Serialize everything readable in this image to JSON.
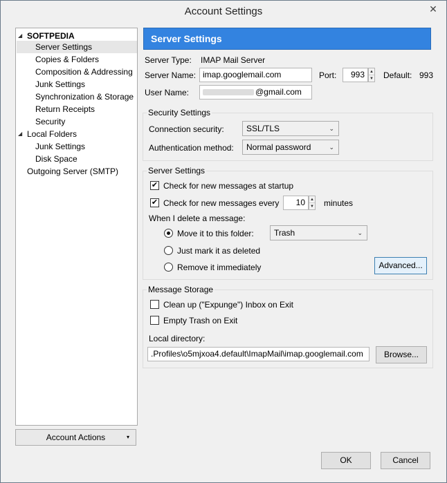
{
  "window": {
    "title": "Account Settings",
    "close_glyph": "✕"
  },
  "tree": {
    "items": [
      {
        "label": "SOFTPEDIA",
        "level": 0,
        "expanded": true,
        "bold": true
      },
      {
        "label": "Server Settings",
        "level": 1,
        "selected": true
      },
      {
        "label": "Copies & Folders",
        "level": 1
      },
      {
        "label": "Composition & Addressing",
        "level": 1
      },
      {
        "label": "Junk Settings",
        "level": 1
      },
      {
        "label": "Synchronization & Storage",
        "level": 1
      },
      {
        "label": "Return Receipts",
        "level": 1
      },
      {
        "label": "Security",
        "level": 1
      },
      {
        "label": "Local Folders",
        "level": 0,
        "expanded": true
      },
      {
        "label": "Junk Settings",
        "level": 1
      },
      {
        "label": "Disk Space",
        "level": 1
      },
      {
        "label": "Outgoing Server (SMTP)",
        "level": 0
      }
    ],
    "toggle_glyph": "◢"
  },
  "account_actions": {
    "label": "Account Actions",
    "caret": "▾"
  },
  "header": {
    "title": "Server Settings"
  },
  "server": {
    "type_label": "Server Type:",
    "type_value": "IMAP Mail Server",
    "name_label": "Server Name:",
    "name_value": "imap.googlemail.com",
    "port_label": "Port:",
    "port_value": "993",
    "default_label": "Default:",
    "default_value": "993",
    "user_label": "User Name:",
    "user_value": "@gmail.com"
  },
  "security": {
    "group_title": "Security Settings",
    "connection_label": "Connection security:",
    "connection_value": "SSL/TLS",
    "auth_label": "Authentication method:",
    "auth_value": "Normal password"
  },
  "server_settings": {
    "group_title": "Server Settings",
    "check_startup_label": "Check for new messages at startup",
    "check_startup": true,
    "check_every_label": "Check for new messages every",
    "check_every": true,
    "minutes_value": "10",
    "minutes_label": "minutes",
    "delete_label": "When I delete a message:",
    "move_label": "Move it to this folder:",
    "folder_value": "Trash",
    "mark_label": "Just mark it as deleted",
    "remove_label": "Remove it immediately",
    "selected_delete_option": "move",
    "advanced_label": "Advanced..."
  },
  "storage": {
    "group_title": "Message Storage",
    "expunge_label": "Clean up (\"Expunge\") Inbox on Exit",
    "expunge": false,
    "empty_trash_label": "Empty Trash on Exit",
    "empty_trash": false,
    "local_dir_label": "Local directory:",
    "local_dir_value": ".Profiles\\o5mjxoa4.default\\ImapMail\\imap.googlemail.com",
    "browse_label": "Browse..."
  },
  "footer": {
    "ok_label": "OK",
    "cancel_label": "Cancel"
  },
  "glyphs": {
    "check": "✔",
    "dropdown_arrow": "⌄",
    "spin_up": "▲",
    "spin_down": "▼"
  },
  "colors": {
    "header_blue": "#3383e0",
    "selection_gray": "#e6e6e6"
  }
}
